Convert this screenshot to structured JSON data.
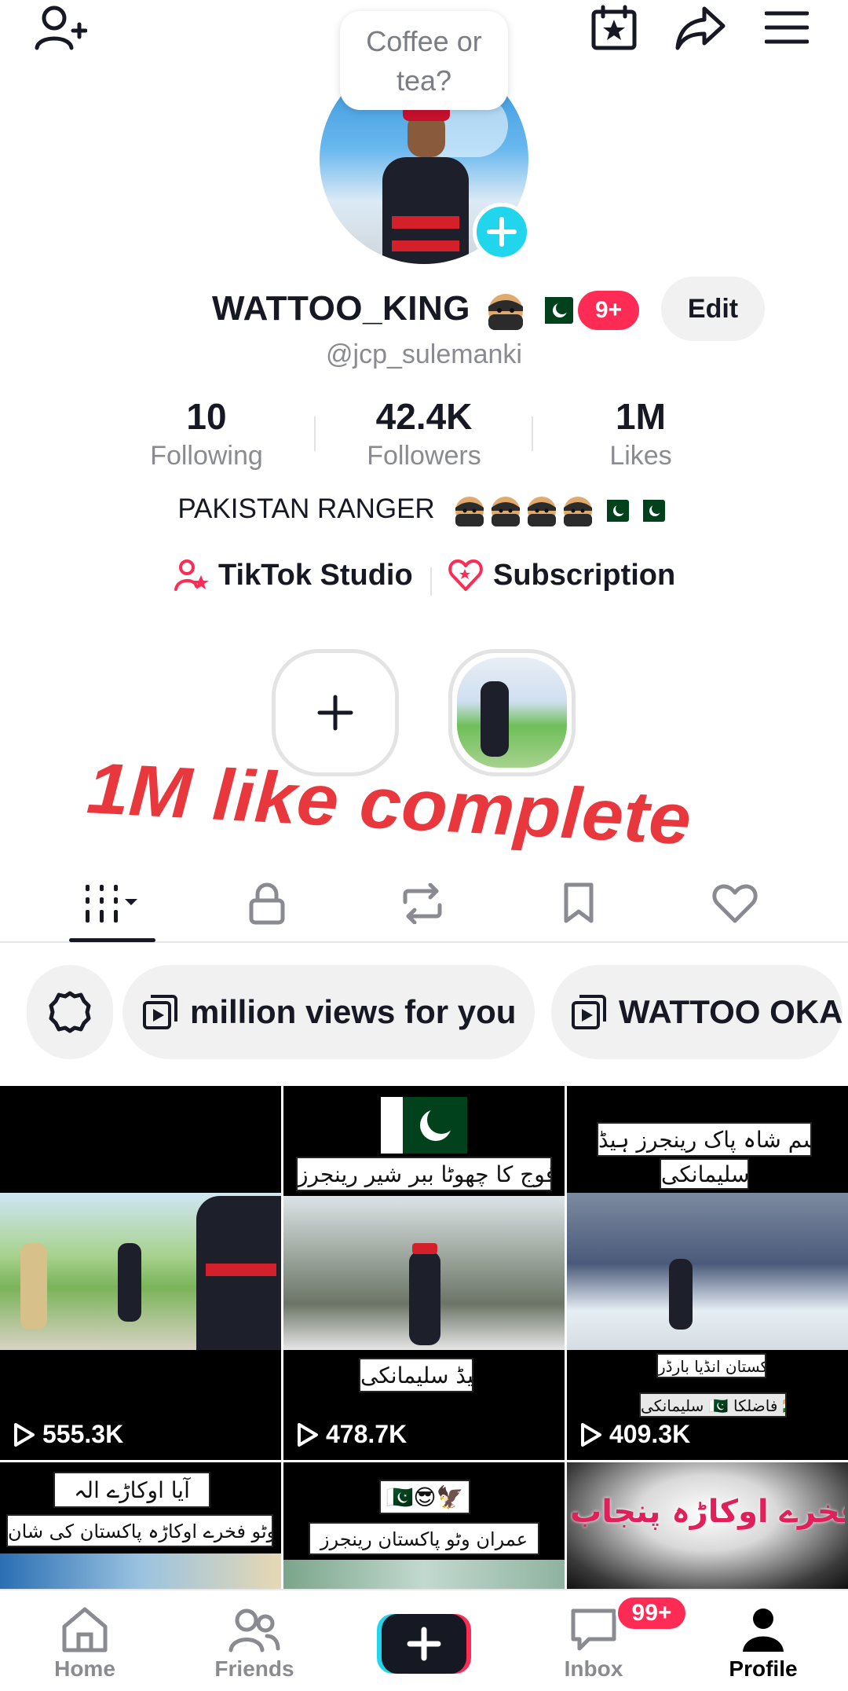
{
  "header": {
    "bubble_text": "Coffee or tea?",
    "icons": [
      "add-friend-icon",
      "calendar-star-icon",
      "share-icon",
      "menu-icon"
    ]
  },
  "profile": {
    "display_name": "WATTOO_KING",
    "name_emojis": [
      "ninja-emoji",
      "pakistan-flag-emoji"
    ],
    "notification_count": "9+",
    "edit_label": "Edit",
    "handle": "@jcp_sulemanki"
  },
  "stats": {
    "following": {
      "value": "10",
      "label": "Following"
    },
    "followers": {
      "value": "42.4K",
      "label": "Followers"
    },
    "likes": {
      "value": "1M",
      "label": "Likes"
    }
  },
  "bio": {
    "text": "PAKISTAN RANGER",
    "emojis": [
      "ninja-emoji",
      "ninja-emoji",
      "ninja-emoji",
      "ninja-emoji",
      "pakistan-flag-emoji",
      "pakistan-flag-emoji"
    ]
  },
  "links": {
    "studio": "TikTok Studio",
    "subscription": "Subscription"
  },
  "overlay": {
    "text": "1M like complete",
    "color": "#e8383d"
  },
  "tabs": [
    "videos-tab",
    "private-tab",
    "reposts-tab",
    "favorites-tab",
    "liked-tab"
  ],
  "chips": {
    "chip1": "million views for you",
    "chip2": "WATTOO OKA"
  },
  "videos": [
    {
      "views": "555.3K"
    },
    {
      "views": "478.7K",
      "caption_top": "پاک فوج کا چھوٹا ببر شیر رینجرز",
      "caption_bottom": "ہیڈ سلیمانکی"
    },
    {
      "views": "409.3K",
      "caption_top": "قاسم شاہ پاک رینجرز ہیڈ",
      "caption_top2": "سلیمانکی",
      "caption_bottom": "پاکستان انڈیا بارڈر",
      "caption_bottom2": "سلیمانکی 🇵🇰 فاضلکا 🇮🇳"
    },
    {
      "caption_top": "آیا اوکاڑے الہ",
      "caption_bottom": "عمران وٹو فخرے اوکاڑہ پاکستان کی شان"
    },
    {
      "caption_top": "🇵🇰😎🦅",
      "caption_bottom": "عمران وٹو پاکستان رینجرز"
    },
    {
      "caption_top": "عمران وٹو فخرے اوکاڑہ پنجاب"
    }
  ],
  "nav": {
    "home": "Home",
    "friends": "Friends",
    "inbox": "Inbox",
    "inbox_badge": "99+",
    "profile": "Profile"
  },
  "colors": {
    "accent_red": "#fe2c55",
    "accent_cyan": "#20d5ec",
    "text_primary": "#161823",
    "text_secondary": "#8a8b91"
  }
}
